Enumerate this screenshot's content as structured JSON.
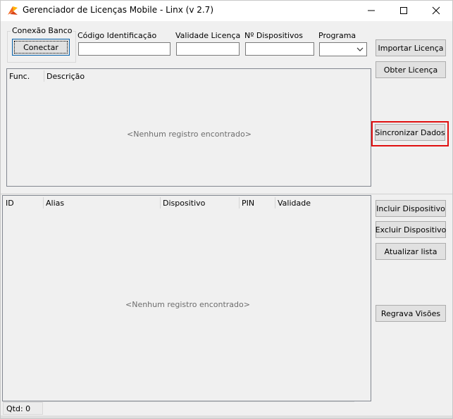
{
  "window": {
    "title": "Gerenciador de Licenças Mobile - Linx (v 2.7)",
    "minimize_icon": "minimize-icon",
    "maximize_icon": "maximize-icon",
    "close_icon": "close-icon",
    "app_icon": "linx-logo-icon"
  },
  "connection": {
    "group_label": "Conexão Banco",
    "connect_button": "Conectar"
  },
  "fields": {
    "codigo_label": "Código Identificação",
    "codigo_value": "",
    "validade_label": "Validade Licença",
    "validade_value": "",
    "dispositivos_label": "Nº Dispositivos",
    "dispositivos_value": "",
    "programa_label": "Programa",
    "programa_value": ""
  },
  "license_actions": {
    "importar": "Importar Licença",
    "obter": "Obter Licença",
    "sincronizar": "Sincronizar Dados"
  },
  "functions_grid": {
    "columns": [
      "Func.",
      "Descrição"
    ],
    "rows": [],
    "empty_message": "<Nenhum registro encontrado>"
  },
  "devices_grid": {
    "columns": [
      "ID",
      "Alias",
      "Dispositivo",
      "PIN",
      "Validade"
    ],
    "rows": [],
    "empty_message": "<Nenhum registro encontrado>"
  },
  "device_actions": {
    "incluir": "Incluir Dispositivo",
    "excluir": "Excluir Dispositivo",
    "atualizar": "Atualizar lista",
    "regrava": "Regrava Visões"
  },
  "status": {
    "qtd": "Qtd: 0"
  },
  "colors": {
    "highlight": "#e01010",
    "window_bg": "#f0f0f0",
    "button_bg": "#e1e1e1"
  }
}
